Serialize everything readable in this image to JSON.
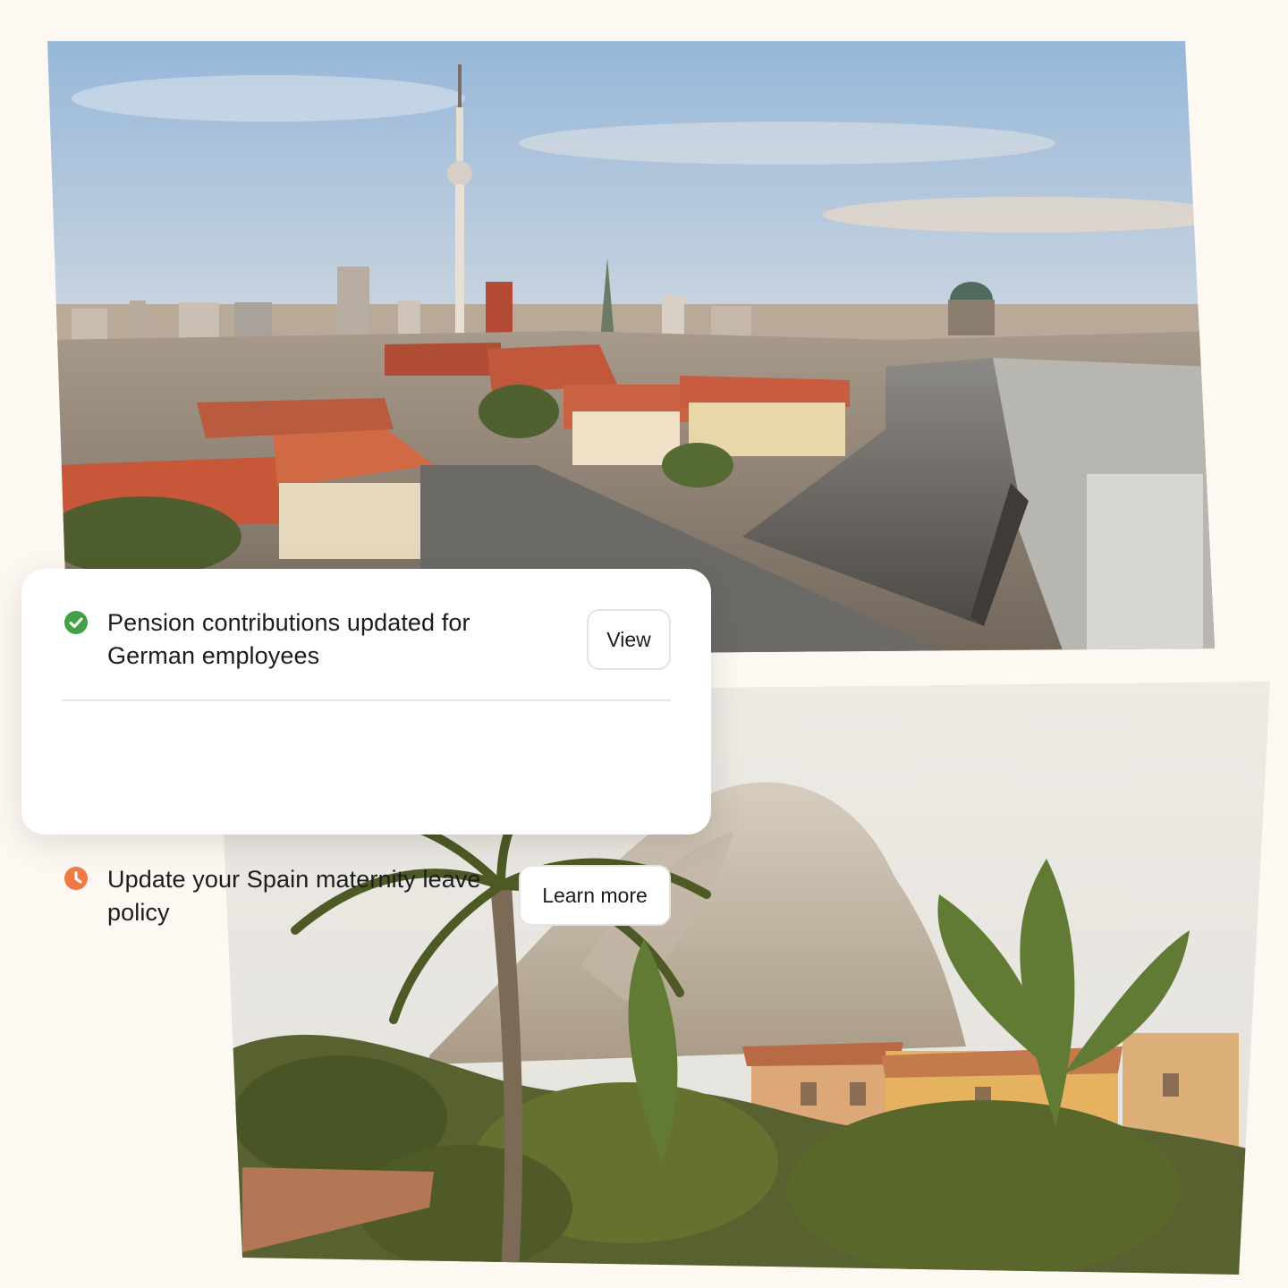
{
  "notifications": [
    {
      "status_icon": "check-circle-icon",
      "status_color": "#43a047",
      "message": "Pension contributions updated for German employees",
      "action_label": "View"
    },
    {
      "status_icon": "clock-icon",
      "status_color": "#f07a44",
      "message": "Update your Spain maternity leave policy",
      "action_label": "Learn more"
    }
  ],
  "images": [
    {
      "name": "berlin-skyline-photo"
    },
    {
      "name": "spain-coast-palms-photo"
    }
  ],
  "colors": {
    "background": "#fdf9f2",
    "card": "#ffffff",
    "button_border": "#e4e4e4"
  }
}
